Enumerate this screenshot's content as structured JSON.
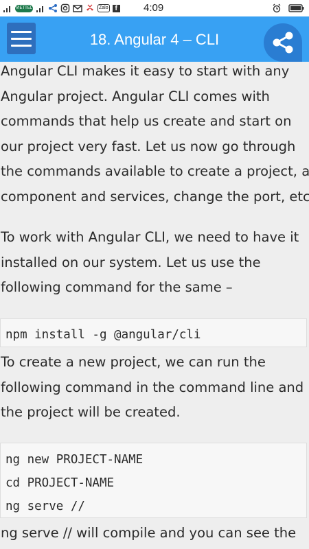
{
  "status_bar": {
    "carrier": "VIETTEL",
    "time": "4:09",
    "zalo": "Zalo",
    "fb": "f"
  },
  "app_bar": {
    "title": "18. Angular 4 – CLI",
    "menu_icon": "hamburger-menu-icon",
    "share_icon": "share-icon",
    "color": "#38a1f3"
  },
  "content": {
    "para1": [
      "Angular CLI makes it easy to start with any",
      "Angular project. Angular CLI comes with",
      "commands that help us create and start on",
      "our project very fast. Let us now go through",
      "the commands available to create a project, a",
      "component and services, change the port, etc."
    ],
    "para2": [
      "To work with Angular CLI, we need to have it",
      "installed on our system. Let us use the",
      "following command for the same –"
    ],
    "code1": [
      "npm install -g @angular/cli"
    ],
    "para3": [
      "To create a new project, we can run the",
      "following command in the command line and",
      "the project will be created."
    ],
    "code2": [
      "ng new PROJECT-NAME",
      "cd PROJECT-NAME",
      "ng serve //"
    ],
    "para4": [
      "ng serve // will compile and you can see the"
    ]
  }
}
